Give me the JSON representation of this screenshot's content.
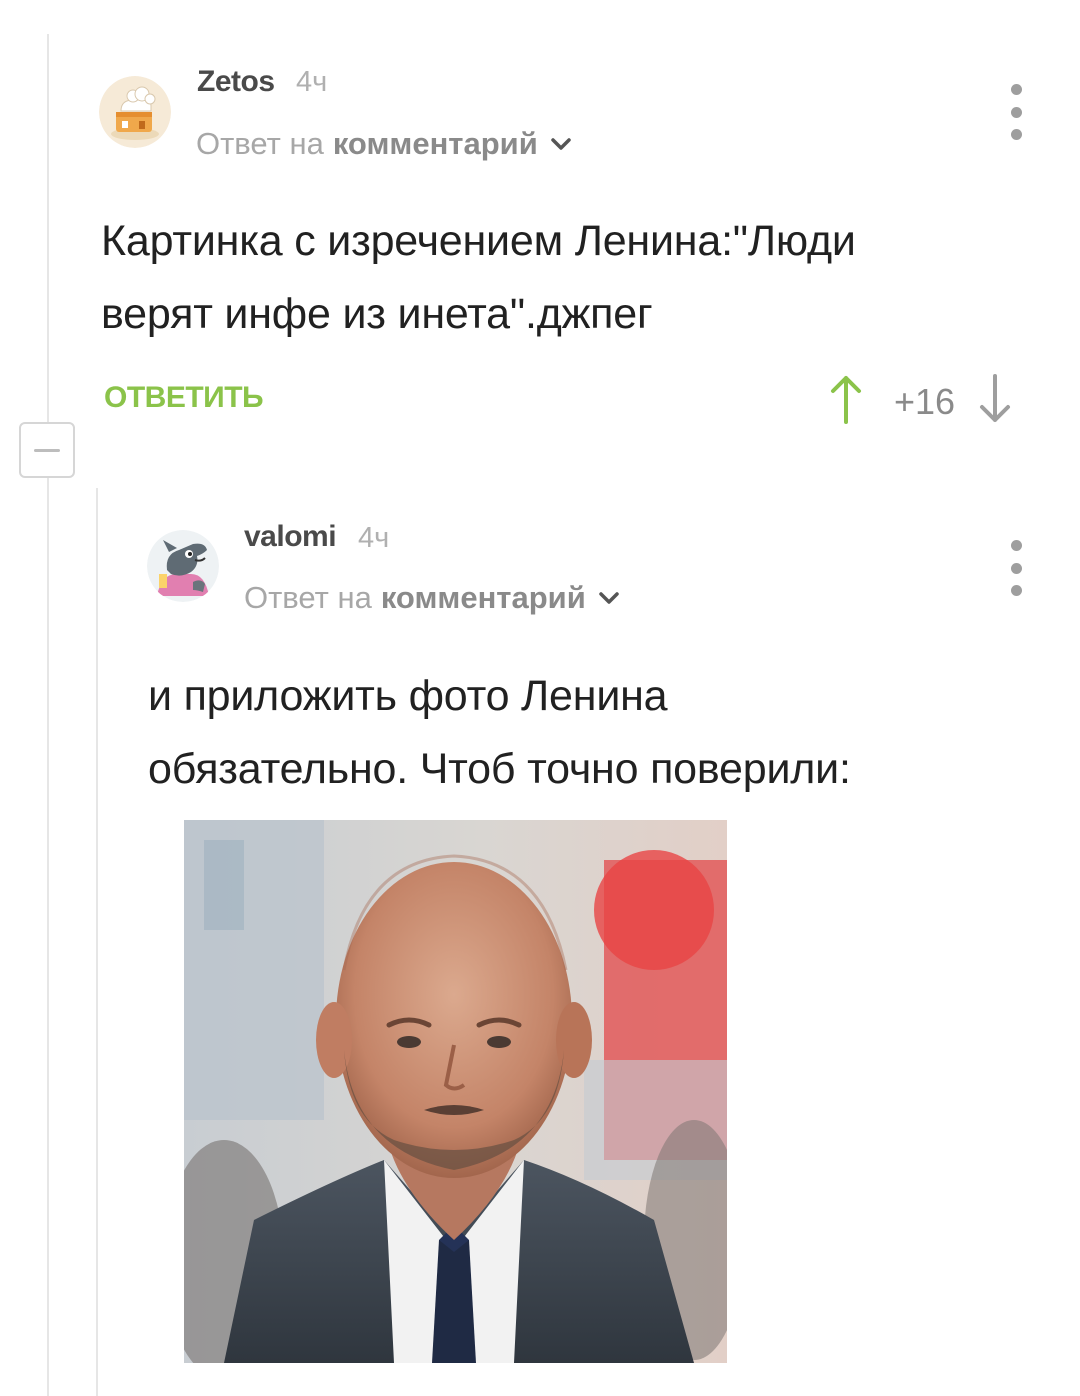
{
  "colors": {
    "accent_green": "#8bc34a",
    "muted_text": "#a7a7a7",
    "thread_line": "#e6e6e6"
  },
  "comments": [
    {
      "username": "Zetos",
      "time": "4ч",
      "reply_to_prefix": "Ответ на",
      "reply_to_link": "комментарий",
      "text_lines": [
        "Картинка с изречением Ленина:\"Люди",
        "верят инфе из инета\".джпег"
      ],
      "reply_label": "ОТВЕТИТЬ",
      "rating": "+16",
      "icons": [
        "chef-house-avatar",
        "chevron-down-icon",
        "more-vertical-icon",
        "arrow-up-icon",
        "arrow-down-icon"
      ]
    },
    {
      "username": "valomi",
      "time": "4ч",
      "reply_to_prefix": "Ответ на",
      "reply_to_link": "комментарий",
      "text_lines": [
        "и приложить фото Ленина",
        "обязательно. Чтоб точно поверили:"
      ],
      "icons": [
        "wolf-cartoon-avatar",
        "chevron-down-icon",
        "more-vertical-icon"
      ],
      "attachment": "photo of a bald bearded man in a suit"
    }
  ]
}
